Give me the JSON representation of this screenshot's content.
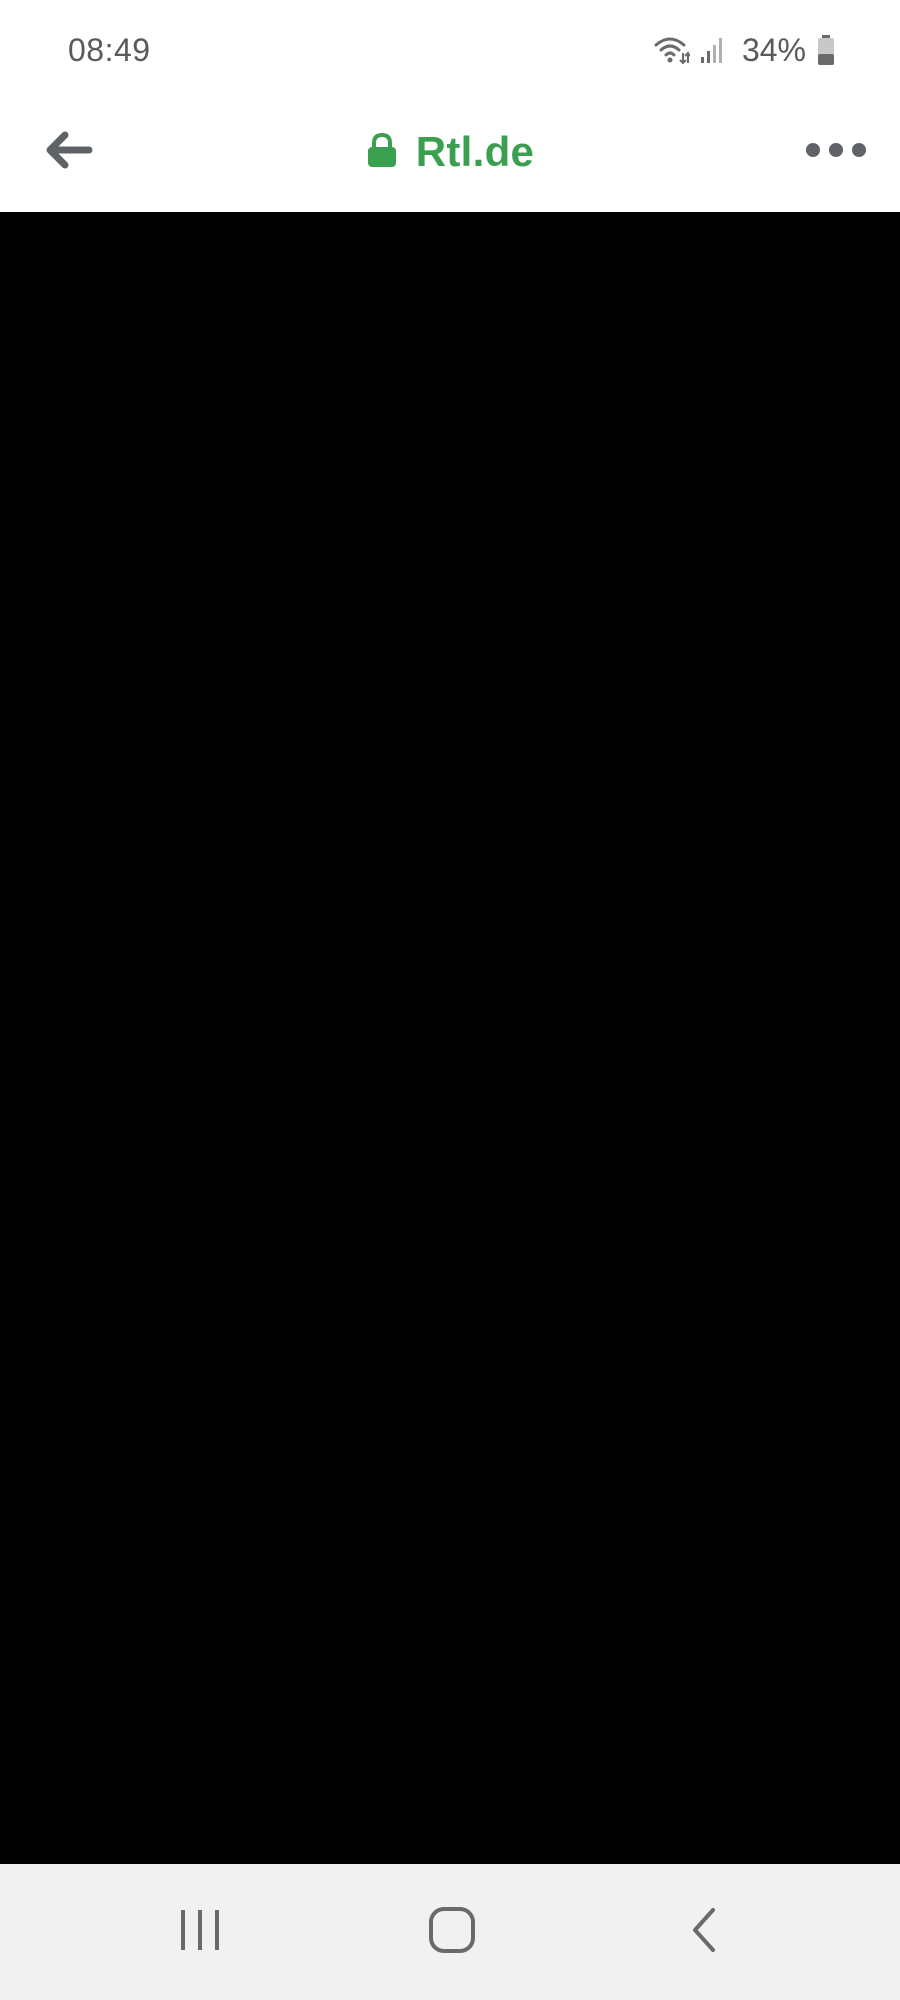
{
  "status_bar": {
    "time": "08:49",
    "battery_percent": "34%",
    "battery_level": 0.34,
    "icons": [
      "wifi-icon",
      "signal-icon",
      "battery-icon"
    ]
  },
  "toolbar": {
    "back_icon": "back-arrow-icon",
    "lock_icon": "lock-icon",
    "url": "Rtl.de",
    "menu_icon": "more-horizontal-icon"
  },
  "content": {
    "background": "#000000"
  },
  "nav_bar": {
    "icons": [
      "recents-icon",
      "home-icon",
      "back-chevron-icon"
    ]
  },
  "colors": {
    "accent_green": "#3aa04f",
    "icon_gray": "#5f6368",
    "status_text": "#5a5a5a",
    "nav_background": "#f1f1f1"
  }
}
